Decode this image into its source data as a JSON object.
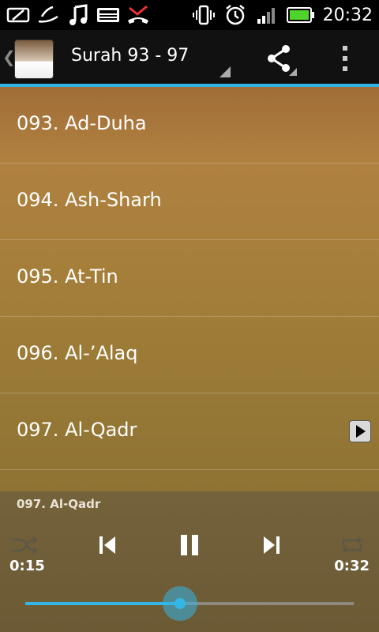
{
  "status_bar": {
    "time": "20:32",
    "icons": [
      "tablet-icon",
      "antenna-icon",
      "music-note-icon",
      "keyboard-icon",
      "missed-call-icon",
      "vibrate-icon",
      "alarm-icon",
      "signal-icon",
      "battery-icon"
    ]
  },
  "action_bar": {
    "title": "Surah 93 - 97",
    "accent": "#33b5e5"
  },
  "list": {
    "items": [
      {
        "label": "093. Ad-Duha"
      },
      {
        "label": "094. Ash-Sharh"
      },
      {
        "label": "095. At-Tin"
      },
      {
        "label": "096. Al-’Alaq"
      },
      {
        "label": "097. Al-Qadr",
        "playing": true
      }
    ]
  },
  "player": {
    "now_playing": "097. Al-Qadr",
    "elapsed": "0:15",
    "duration": "0:32",
    "progress": 0.47
  }
}
